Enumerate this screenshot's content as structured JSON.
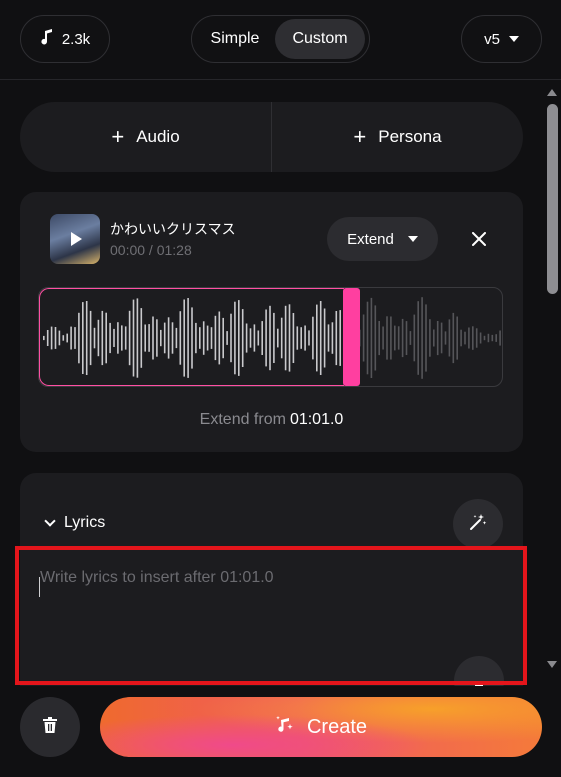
{
  "header": {
    "credits": "2.3k",
    "modes": [
      "Simple",
      "Custom"
    ],
    "active_mode": "Custom",
    "version": "v5"
  },
  "add_row": {
    "audio_label": "Audio",
    "persona_label": "Persona"
  },
  "track": {
    "title": "かわいいクリスマス",
    "time": "00:00 / 01:28",
    "extend_label": "Extend",
    "extend_from_label": "Extend from",
    "extend_from_time": "01:01.0",
    "selection_fraction": 0.66
  },
  "lyrics": {
    "header": "Lyrics",
    "placeholder": "Write lyrics to insert after 01:01.0",
    "value": ""
  },
  "footer": {
    "create_label": "Create"
  },
  "colors": {
    "background": "#101012",
    "card": "#1c1c1f",
    "accent_pink": "#ff3fa0",
    "highlight_red": "#e4151b"
  },
  "icons": [
    "music-note-icon",
    "chevron-down-icon",
    "plus-icon",
    "play-icon",
    "close-icon",
    "magic-wand-icon",
    "trash-icon",
    "sparkle-music-icon"
  ]
}
